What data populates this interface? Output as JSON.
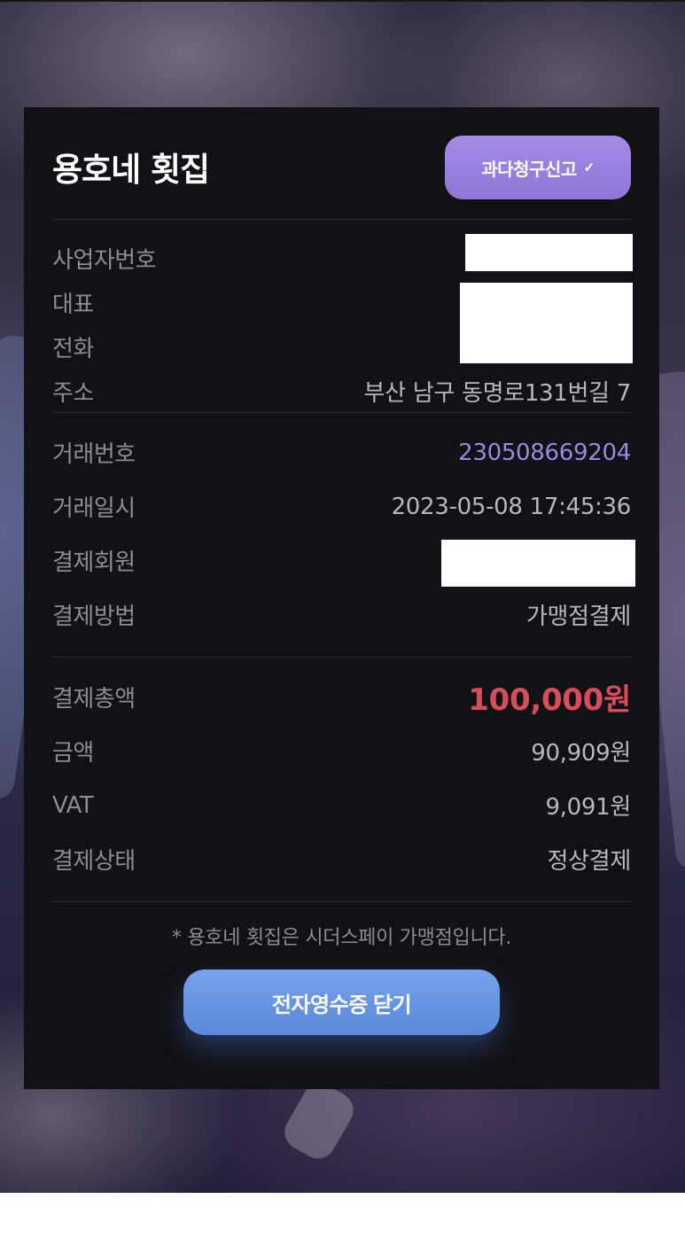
{
  "store": {
    "name": "용호네 횟집",
    "report_button_label": "과다청구신고",
    "report_button_icon": "chevron-down-icon"
  },
  "business": {
    "registration_label": "사업자번호",
    "registration_value": "",
    "ceo_label": "대표",
    "ceo_value": "",
    "phone_label": "전화",
    "phone_value": "",
    "address_label": "주소",
    "address_value": "부산 남구 동명로131번길 7"
  },
  "transaction": {
    "number_label": "거래번호",
    "number_value": "230508669204",
    "datetime_label": "거래일시",
    "datetime_value": "2023-05-08 17:45:36",
    "member_label": "결제회원",
    "member_value": "",
    "method_label": "결제방법",
    "method_value": "가맹점결제"
  },
  "payment": {
    "total_label": "결제총액",
    "total_value": "100,000원",
    "amount_label": "금액",
    "amount_value": "90,909원",
    "vat_label": "VAT",
    "vat_value": "9,091원",
    "status_label": "결제상태",
    "status_value": "정상결제"
  },
  "footer": {
    "note": "* 용호네 횟집은 시더스페이 가맹점입니다.",
    "close_button_label": "전자영수증 닫기"
  },
  "colors": {
    "card_background": "#111216",
    "report_button": "#9a80de",
    "link_value": "#9d86e0",
    "total_value": "#d74d5c",
    "close_button": "#6894e0"
  }
}
